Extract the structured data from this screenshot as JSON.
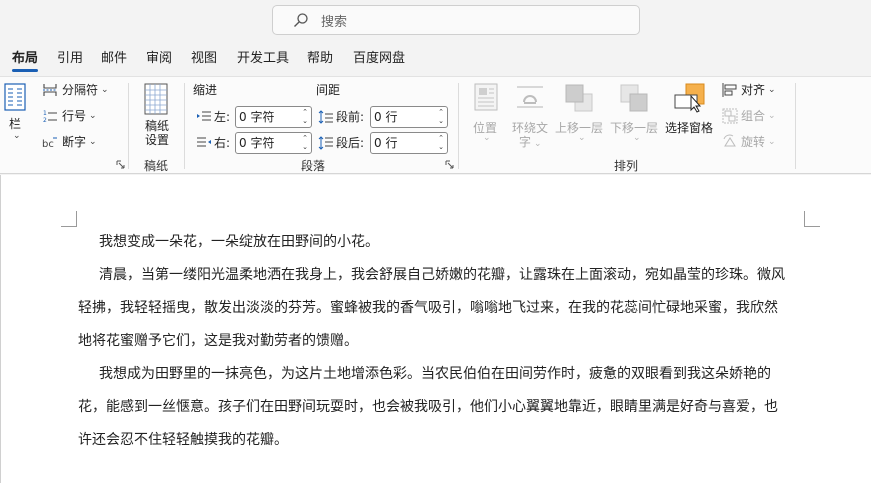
{
  "search": {
    "placeholder": "搜索"
  },
  "tabs": [
    "布局",
    "引用",
    "邮件",
    "审阅",
    "视图",
    "开发工具",
    "帮助",
    "百度网盘"
  ],
  "ribbon": {
    "columns_label": "栏",
    "page_setup": {
      "breaks": "分隔符",
      "line_numbers": "行号",
      "hyphenation": "断字"
    },
    "manuscript": {
      "button": "稿纸\n设置",
      "group": "稿纸"
    },
    "paragraph": {
      "indent_title": "缩进",
      "spacing_title": "间距",
      "left_label": "左:",
      "right_label": "右:",
      "before_label": "段前:",
      "after_label": "段后:",
      "left_value": "0 字符",
      "right_value": "0 字符",
      "before_value": "0 行",
      "after_value": "0 行",
      "group": "段落"
    },
    "arrange": {
      "position": "位置",
      "wrap_text_1": "环绕文",
      "wrap_text_2": "字",
      "bring_forward": "上移一层",
      "send_backward": "下移一层",
      "selection_pane": "选择窗格",
      "align": "对齐",
      "group_btn": "组合",
      "rotate": "旋转",
      "group": "排列"
    }
  },
  "document": {
    "paragraphs": [
      "我想变成一朵花，一朵绽放在田野间的小花。",
      "清晨，当第一缕阳光温柔地洒在我身上，我会舒展自己娇嫩的花瓣，让露珠在上面滚动，宛如晶莹的珍珠。微风",
      "轻拂，我轻轻摇曳，散发出淡淡的芬芳。蜜蜂被我的香气吸引，嗡嗡地飞过来，在我的花蕊间忙碌地采蜜，我欣然",
      "地将花蜜赠予它们，这是我对勤劳者的馈赠。",
      "我想成为田野里的一抹亮色，为这片土地增添色彩。当农民伯伯在田间劳作时，疲惫的双眼看到我这朵娇艳的",
      "花，能感到一丝惬意。孩子们在田野间玩耍时，也会被我吸引，他们小心翼翼地靠近，眼睛里满是好奇与喜爱，也",
      "许还会忍不住轻轻触摸我的花瓣。"
    ]
  },
  "colors": {
    "accent": "#1a5fb4",
    "selection_pane_icon": "#f5b04c"
  }
}
